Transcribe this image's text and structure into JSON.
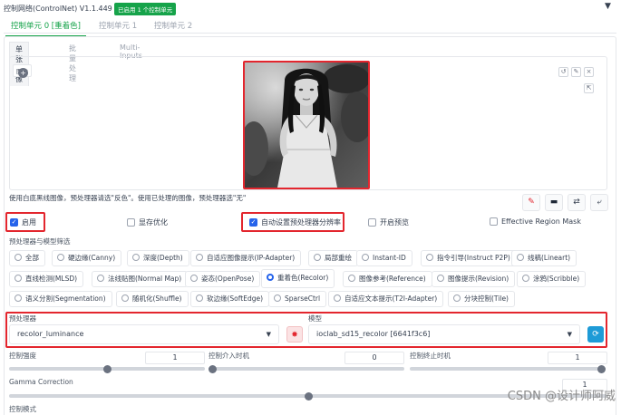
{
  "header": {
    "title": "控制网络(ControlNet) V1.1.449",
    "badge": "已启用 1 个控制单元",
    "collapse_glyph": "▼"
  },
  "unit_tabs": [
    "控制单元 0 [重着色]",
    "控制单元 1",
    "控制单元 2"
  ],
  "image_tabs": [
    "单张图像",
    "批量处理",
    "Multi-Inputs"
  ],
  "image_panel": {
    "label": "图像",
    "upload_glyph": "+",
    "mini_tools": [
      "↺",
      "✎",
      "×"
    ],
    "side_tool": "⇱"
  },
  "hint": "使用白底黑线图像，预处理器请选\"反色\"。使用已处理的图像，预处理器选\"无\"",
  "icon_buttons": [
    "✎",
    "▬",
    "⇄",
    "⤶"
  ],
  "checkboxes": {
    "enable": {
      "label": "启用",
      "checked": true
    },
    "lowvram": {
      "label": "显存优化",
      "checked": false
    },
    "pixel_perfect": {
      "label": "自动设置预处理器分辨率",
      "checked": true
    },
    "preview": {
      "label": "开启预览",
      "checked": false
    },
    "effective_mask": {
      "label": "Effective Region Mask",
      "checked": false
    }
  },
  "filter_label": "预处理器与模型筛选",
  "control_types": [
    "全部",
    "硬边缘(Canny)",
    "深度(Depth)",
    "自适应图像提示(IP-Adapter)",
    "局部重绘",
    "Instant-ID",
    "指令引导(Instruct P2P)",
    "线稿(Lineart)",
    "直线检测(MLSD)",
    "法线贴图(Normal Map)",
    "姿态(OpenPose)",
    "重着色(Recolor)",
    "图像参考(Reference)",
    "图像提示(Revision)",
    "涂鸦(Scribble)",
    "语义分割(Segmentation)",
    "随机化(Shuffle)",
    "软边缘(SoftEdge)",
    "SparseCtrl",
    "自适应文本提示(T2I-Adapter)",
    "分块控制(Tile)"
  ],
  "selected_control_type": "重着色(Recolor)",
  "preprocessor": {
    "label": "预处理器",
    "value": "recolor_luminance",
    "run_glyph": "✸"
  },
  "model": {
    "label": "模型",
    "value": "ioclab_sd15_recolor [6641f3c6]",
    "refresh_glyph": "⟳"
  },
  "sliders": {
    "weight": {
      "label": "控制强度",
      "value": "1",
      "fraction": 0.5
    },
    "start": {
      "label": "控制介入时机",
      "value": "0",
      "fraction": 0.0
    },
    "end": {
      "label": "控制终止时机",
      "value": "1",
      "fraction": 1.0
    },
    "gamma": {
      "label": "Gamma Correction",
      "value": "1",
      "fraction": 0.5
    }
  },
  "control_mode_label": "控制模式",
  "watermark": "CSDN @设计师阿威",
  "colors": {
    "accent_green": "#16a34a",
    "highlight_red": "#e3262e",
    "checkbox_blue": "#2563eb",
    "refresh_blue": "#1e9bd7"
  }
}
